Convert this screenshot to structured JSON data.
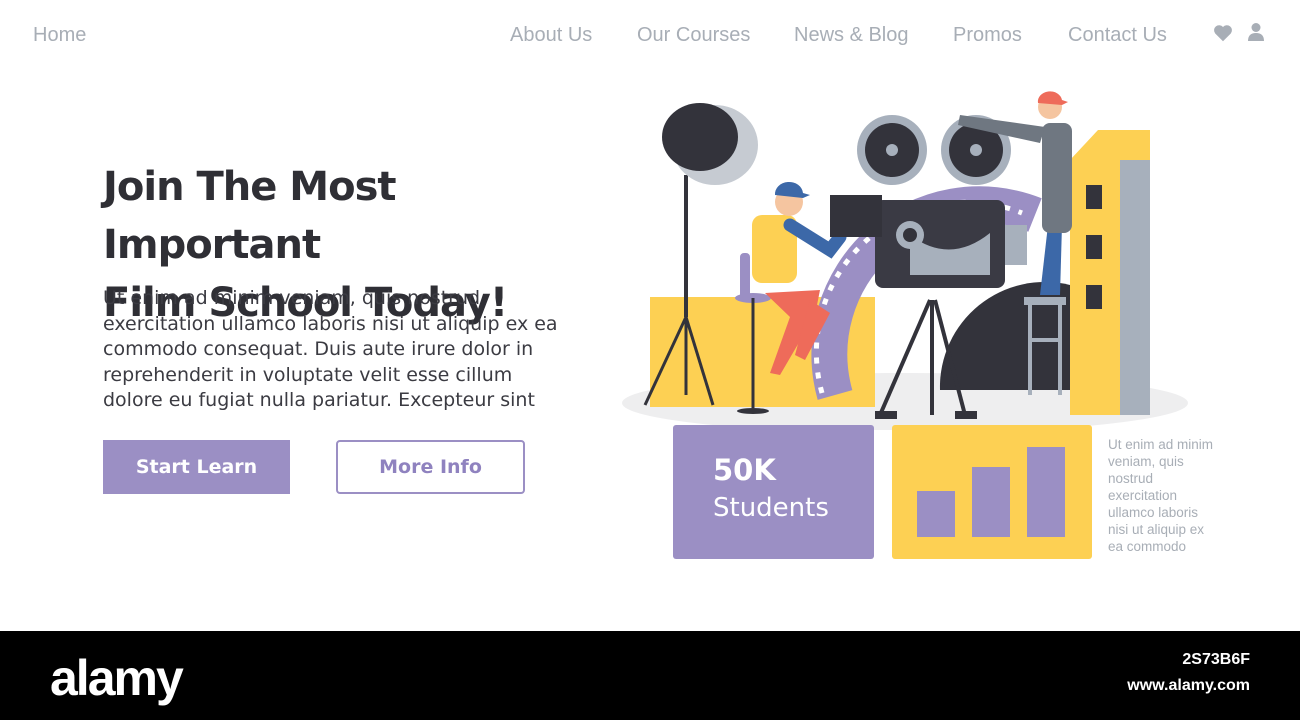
{
  "nav": {
    "home": "Home",
    "about": "About Us",
    "courses": "Our Courses",
    "news": "News & Blog",
    "promos": "Promos",
    "contact": "Contact Us",
    "icons": [
      "heart-icon",
      "user-icon"
    ]
  },
  "hero": {
    "title_line1": "Join The Most Important",
    "title_line2": "Film School Today!",
    "body": "Ut enim ad minim veniam, quis nostrud exercitation ullamco laboris nisi ut aliquip ex ea commodo consequat. Duis aute irure dolor in reprehenderit in voluptate velit esse cillum dolore eu fugiat nulla pariatur. Excepteur sint"
  },
  "buttons": {
    "start": "Start Learn",
    "more": "More Info"
  },
  "stats": {
    "number": "50K",
    "label": "Students"
  },
  "side_text": "Ut enim ad minim veniam, quis nostrud exercitation ullamco laboris nisi ut aliquip ex ea commodo",
  "footer": {
    "logo": "alamy",
    "image_id": "2S73B6F",
    "url": "www.alamy.com"
  },
  "colors": {
    "purple": "#9b8fc4",
    "yellow": "#fdd053",
    "dark": "#2f2f35",
    "nav_gray": "#a8aeb6"
  }
}
